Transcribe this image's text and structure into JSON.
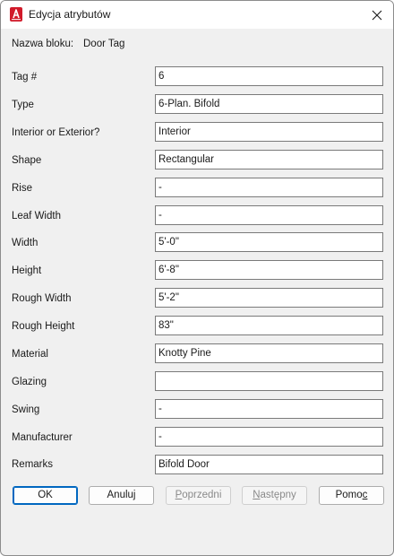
{
  "window": {
    "title": "Edycja atrybutów",
    "icon": "autocad-a-icon",
    "close_icon": "close-icon"
  },
  "block": {
    "label": "Nazwa bloku:",
    "value": "Door Tag"
  },
  "attributes": [
    {
      "label": "Tag #",
      "value": "6"
    },
    {
      "label": "Type",
      "value": "6-Plan. Bifold"
    },
    {
      "label": "Interior or Exterior?",
      "value": "Interior"
    },
    {
      "label": "Shape",
      "value": "Rectangular"
    },
    {
      "label": "Rise",
      "value": "-"
    },
    {
      "label": "Leaf Width",
      "value": "-"
    },
    {
      "label": "Width",
      "value": "5'-0\""
    },
    {
      "label": "Height",
      "value": "6'-8\""
    },
    {
      "label": "Rough Width",
      "value": "5'-2\""
    },
    {
      "label": "Rough Height",
      "value": "83\""
    },
    {
      "label": "Material",
      "value": "Knotty Pine"
    },
    {
      "label": "Glazing",
      "value": ""
    },
    {
      "label": "Swing",
      "value": "-"
    },
    {
      "label": "Manufacturer",
      "value": "-"
    },
    {
      "label": "Remarks",
      "value": "Bifold Door"
    }
  ],
  "buttons": {
    "ok": "OK",
    "cancel": "Anuluj",
    "previous": {
      "before": "",
      "accel": "P",
      "after": "oprzedni"
    },
    "next": {
      "before": "",
      "accel": "N",
      "after": "astępny"
    },
    "help": {
      "before": "Pomo",
      "accel": "c",
      "after": ""
    }
  },
  "colors": {
    "accent": "#0067c0",
    "icon_red": "#d11a2a"
  }
}
